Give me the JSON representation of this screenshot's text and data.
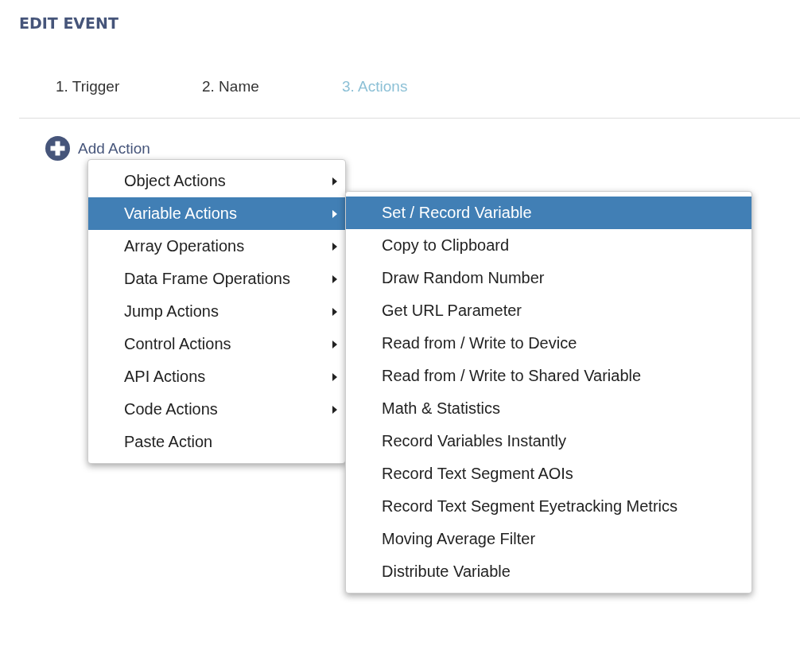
{
  "title": "EDIT EVENT",
  "steps": [
    {
      "label": "1. Trigger",
      "selected": false
    },
    {
      "label": "2. Name",
      "selected": false
    },
    {
      "label": "3. Actions",
      "selected": true
    }
  ],
  "add_action": {
    "label": "Add Action"
  },
  "menu": {
    "items": [
      {
        "label": "Object Actions",
        "has_submenu": true,
        "selected": false
      },
      {
        "label": "Variable Actions",
        "has_submenu": true,
        "selected": true
      },
      {
        "label": "Array Operations",
        "has_submenu": true,
        "selected": false
      },
      {
        "label": "Data Frame Operations",
        "has_submenu": true,
        "selected": false
      },
      {
        "label": "Jump Actions",
        "has_submenu": true,
        "selected": false
      },
      {
        "label": "Control Actions",
        "has_submenu": true,
        "selected": false
      },
      {
        "label": "API Actions",
        "has_submenu": true,
        "selected": false
      },
      {
        "label": "Code Actions",
        "has_submenu": true,
        "selected": false
      },
      {
        "label": "Paste Action",
        "has_submenu": false,
        "selected": false
      }
    ]
  },
  "submenu": {
    "items": [
      {
        "label": "Set / Record Variable",
        "selected": true
      },
      {
        "label": "Copy to Clipboard",
        "selected": false
      },
      {
        "label": "Draw Random Number",
        "selected": false
      },
      {
        "label": "Get URL Parameter",
        "selected": false
      },
      {
        "label": "Read from / Write to Device",
        "selected": false
      },
      {
        "label": "Read from / Write to Shared Variable",
        "selected": false
      },
      {
        "label": "Math & Statistics",
        "selected": false
      },
      {
        "label": "Record Variables Instantly",
        "selected": false
      },
      {
        "label": "Record Text Segment AOIs",
        "selected": false
      },
      {
        "label": "Record Text Segment Eyetracking Metrics",
        "selected": false
      },
      {
        "label": "Moving Average Filter",
        "selected": false
      },
      {
        "label": "Distribute Variable",
        "selected": false
      }
    ]
  }
}
